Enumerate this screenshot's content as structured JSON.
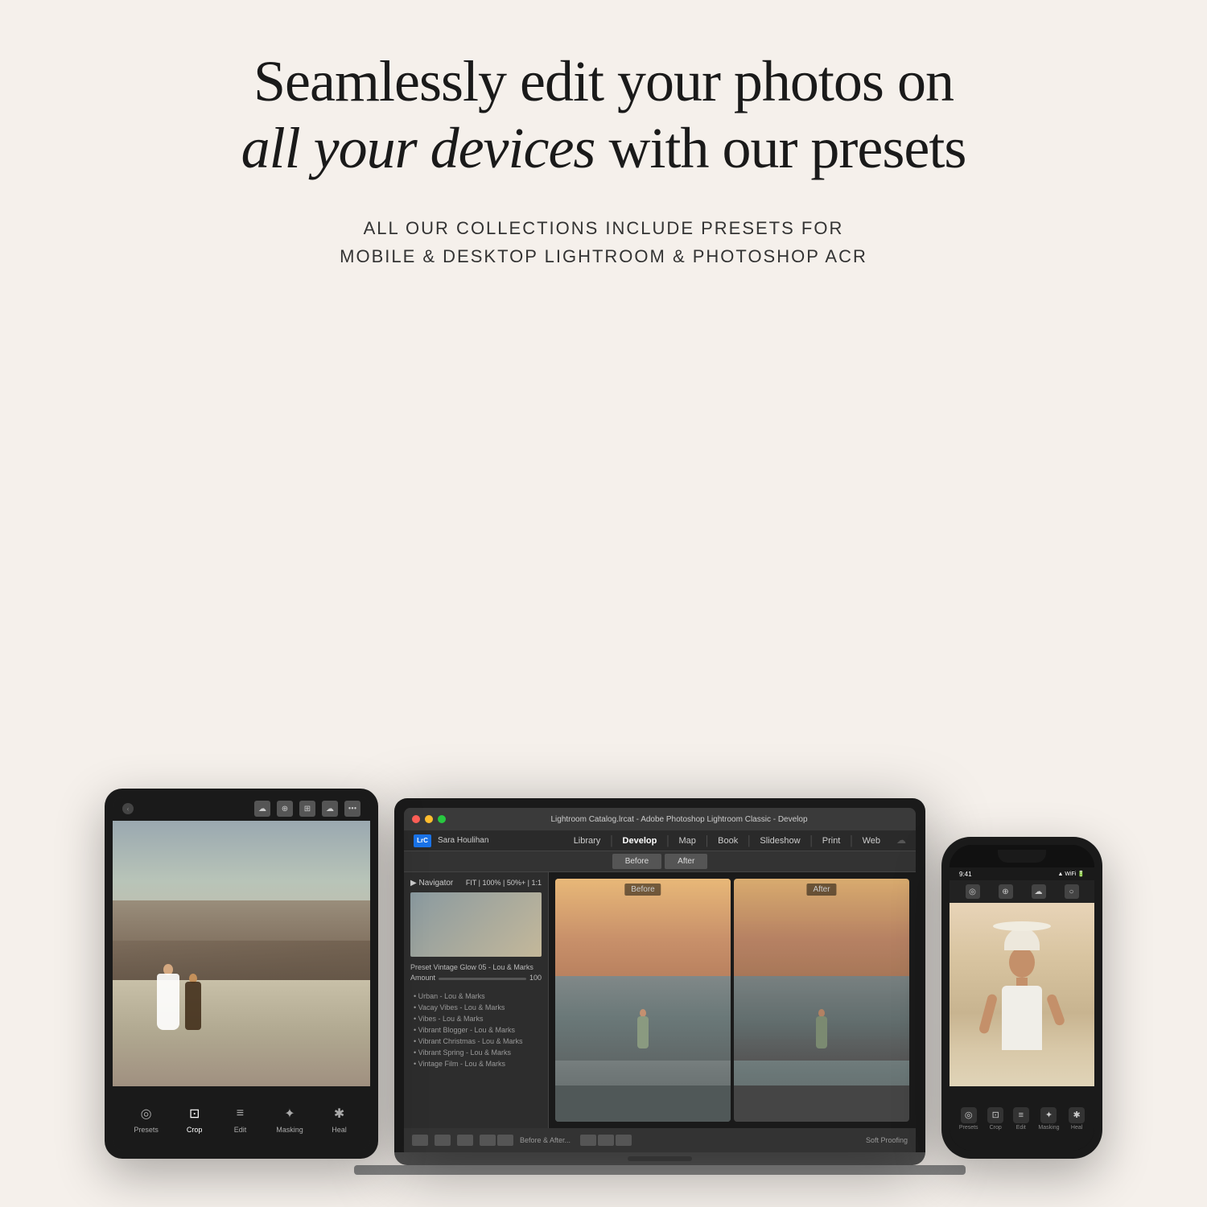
{
  "page": {
    "background_color": "#f5f0eb"
  },
  "headline": {
    "line1": "Seamlessly edit your photos on",
    "line2_italic": "all your devices",
    "line2_rest": " with our presets"
  },
  "subheadline": {
    "line1": "ALL OUR COLLECTIONS INCLUDE PRESETS FOR",
    "line2": "MOBILE & DESKTOP LIGHTROOM & PHOTOSHOP ACR"
  },
  "laptop": {
    "titlebar_text": "Lightroom Catalog.lrcat - Adobe Photoshop Lightroom Classic - Develop",
    "traffic_lights": [
      "red",
      "yellow",
      "green"
    ],
    "badge": "LrC",
    "user": "Sara Houlihan",
    "nav_items": [
      "Library",
      "Develop",
      "Map",
      "Book",
      "Slideshow",
      "Print",
      "Web"
    ],
    "active_nav": "Develop",
    "toolbar_buttons": [
      "Before",
      "After"
    ],
    "navigator_label": "Navigator",
    "preset_label": "Preset  Vintage Glow 05 - Lou & Marks",
    "amount_label": "Amount",
    "amount_value": "100",
    "presets": [
      "Urban - Lou & Marks",
      "Vacay Vibes - Lou & Marks",
      "Vibes - Lou & Marks",
      "Vibrant Blogger - Lou & Marks",
      "Vibrant Christmas - Lou & Marks",
      "Vibrant Spring - Lou & Marks",
      "Vintage Film - Lou & Marks"
    ],
    "before_label": "Before",
    "after_label": "After",
    "bottom_button": "Before & After...",
    "soft_proofing": "Soft Proofing"
  },
  "tablet": {
    "top_icons": [
      "☁",
      "☁",
      "⊕"
    ],
    "tools": [
      {
        "label": "Presets",
        "icon": "◎",
        "active": false
      },
      {
        "label": "Crop",
        "icon": "⊡",
        "active": false
      },
      {
        "label": "Edit",
        "icon": "≡",
        "active": false
      },
      {
        "label": "Masking",
        "icon": "✦",
        "active": false
      },
      {
        "label": "Heal",
        "icon": "✱",
        "active": false
      }
    ]
  },
  "phone": {
    "time": "9:41",
    "status_icons": "●●●",
    "tools": [
      {
        "label": "Presets",
        "icon": "◎",
        "active": false
      },
      {
        "label": "Crop",
        "icon": "⊡",
        "active": false
      },
      {
        "label": "Edit",
        "icon": "≡",
        "active": false
      },
      {
        "label": "Masking",
        "icon": "✦",
        "active": false
      },
      {
        "label": "Heal",
        "icon": "✱",
        "active": false
      }
    ]
  }
}
